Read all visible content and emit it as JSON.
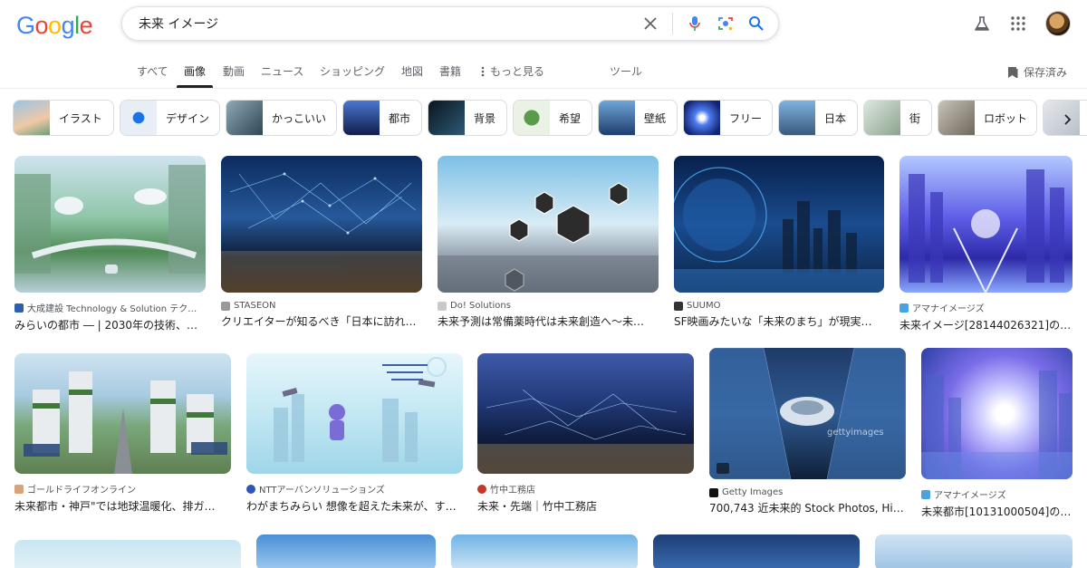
{
  "header": {
    "query": "未来 イメージ",
    "logo_letters": [
      "G",
      "o",
      "o",
      "g",
      "l",
      "e"
    ],
    "logo_colors": [
      "#4285f4",
      "#ea4335",
      "#fbbc05",
      "#4285f4",
      "#34a853",
      "#ea4335"
    ]
  },
  "nav": {
    "tabs": [
      "すべて",
      "画像",
      "動画",
      "ニュース",
      "ショッピング",
      "地図",
      "書籍",
      "もっと見る",
      "ツール"
    ],
    "active_tab": "画像",
    "saved_label": "保存済み"
  },
  "chips": [
    "イラスト",
    "デザイン",
    "かっこいい",
    "都市",
    "背景",
    "希望",
    "壁紙",
    "フリー",
    "日本",
    "街",
    "ロボット"
  ],
  "results": {
    "row1": [
      {
        "source": "大成建設 Technology & Solution テク…",
        "title": "みらいの都市 ― | 2030年の技術、…"
      },
      {
        "source": "STASEON",
        "title": "クリエイターが知るべき「日本に訪れ…"
      },
      {
        "source": "Do! Solutions",
        "title": "未来予測は常備薬時代は未来創造へ〜未…"
      },
      {
        "source": "SUUMO",
        "title": "SF映画みたいな「未来のまち」が現実…"
      },
      {
        "source": "アマナイメージズ",
        "title": "未来イメージ[28144026321]の…"
      }
    ],
    "row2": [
      {
        "source": "ゴールドライフオンライン",
        "title": "未来都市・神戸\"では地球温暖化、排ガ…"
      },
      {
        "source": "NTTアーバンソリューションズ",
        "title": "わがまちみらい 想像を超えた未来が、す…"
      },
      {
        "source": "竹中工務店",
        "title": "未来・先端｜竹中工務店"
      },
      {
        "source": "Getty Images",
        "title": "700,743 近未来的 Stock Photos, Hig…"
      },
      {
        "source": "アマナイメージズ",
        "title": "未来都市[10131000504]の…"
      }
    ]
  },
  "watermark": "gettyimages",
  "colors": {
    "accent": "#1a73e8",
    "text": "#202124",
    "muted": "#5f6368"
  }
}
